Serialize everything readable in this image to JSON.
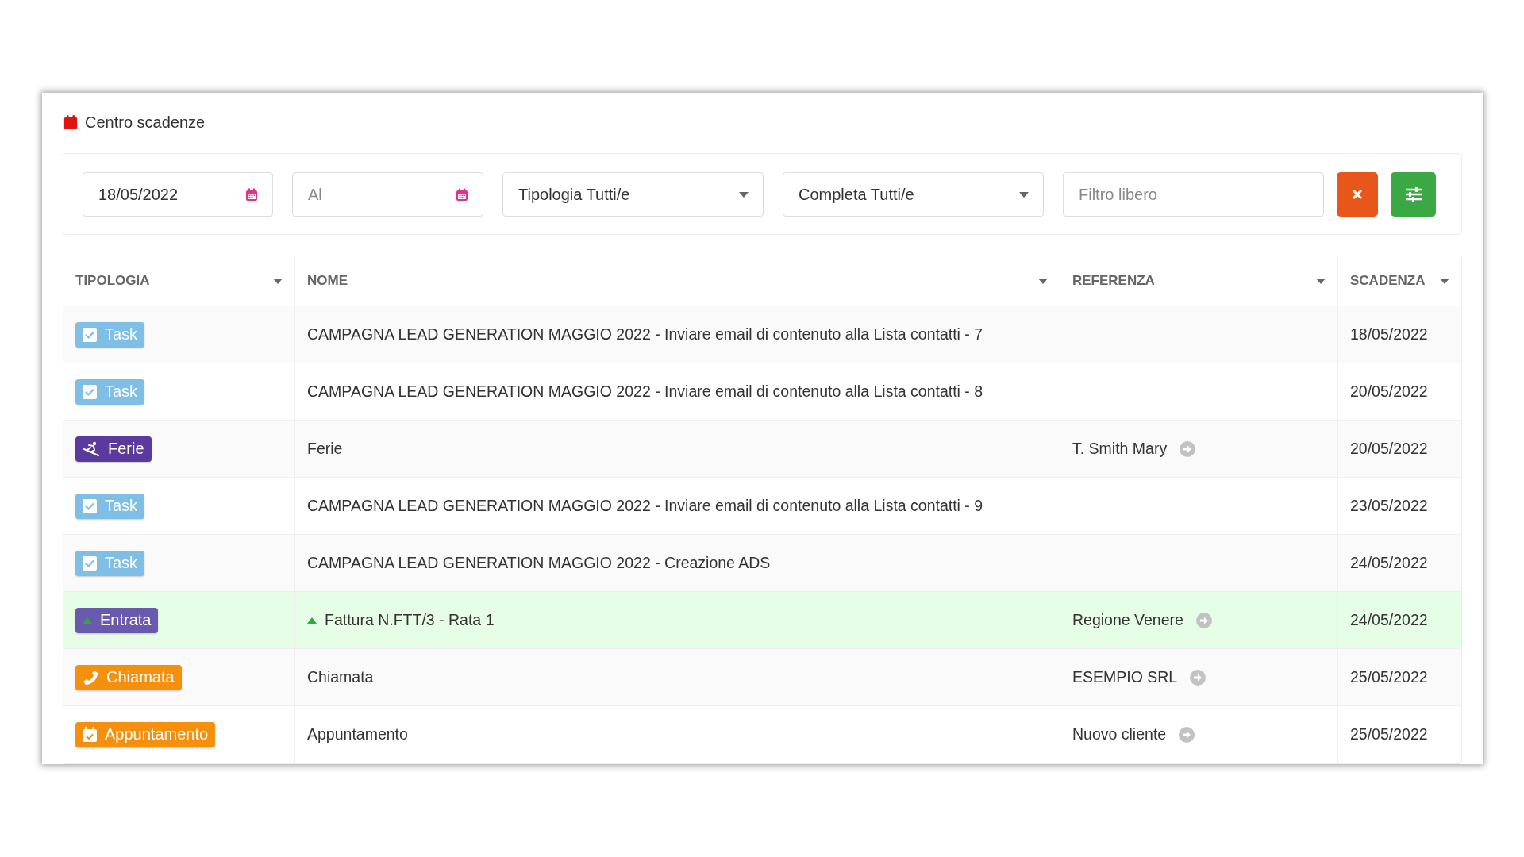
{
  "panel": {
    "title": "Centro scadenze"
  },
  "filters": {
    "date_from": {
      "value": "18/05/2022"
    },
    "date_to": {
      "placeholder": "Al"
    },
    "tipologia": {
      "value": "Tipologia Tutti/e"
    },
    "completa": {
      "value": "Completa Tutti/e"
    },
    "search": {
      "placeholder": "Filtro libero"
    }
  },
  "table": {
    "columns": [
      "TIPOLOGIA",
      "NOME",
      "REFERENZA",
      "SCADENZA"
    ],
    "rows": [
      {
        "kind": "task",
        "badge": "Task",
        "color": "#7fbfe6",
        "nome": "CAMPAGNA LEAD GENERATION MAGGIO 2022 - Inviare email di contenuto alla Lista contatti - 7",
        "scadenza": "18/05/2022",
        "highlighted": false
      },
      {
        "kind": "task",
        "badge": "Task",
        "color": "#7fbfe6",
        "nome": "CAMPAGNA LEAD GENERATION MAGGIO 2022 - Inviare email di contenuto alla Lista contatti - 8",
        "scadenza": "20/05/2022",
        "highlighted": false
      },
      {
        "kind": "ferie",
        "badge": "Ferie",
        "color": "#5a3a9c",
        "nome": "Ferie",
        "referenza": "T. Smith Mary",
        "scadenza": "20/05/2022",
        "highlighted": false
      },
      {
        "kind": "task",
        "badge": "Task",
        "color": "#7fbfe6",
        "nome": "CAMPAGNA LEAD GENERATION MAGGIO 2022 - Inviare email di contenuto alla Lista contatti - 9",
        "scadenza": "23/05/2022",
        "highlighted": false
      },
      {
        "kind": "task",
        "badge": "Task",
        "color": "#7fbfe6",
        "nome": "CAMPAGNA LEAD GENERATION MAGGIO 2022 - Creazione ADS",
        "scadenza": "24/05/2022",
        "highlighted": false
      },
      {
        "kind": "entrata",
        "badge": "Entrata",
        "color": "#6a5aae",
        "nome": "Fattura N.FTT/3 - Rata 1",
        "referenza": "Regione Venere",
        "scadenza": "24/05/2022",
        "highlighted": true
      },
      {
        "kind": "chiamata",
        "badge": "Chiamata",
        "color": "#f5900e",
        "nome": "Chiamata",
        "referenza": "ESEMPIO SRL",
        "scadenza": "25/05/2022",
        "highlighted": false
      },
      {
        "kind": "appuntamento",
        "badge": "Appuntamento",
        "color": "#f5900e",
        "nome": "Appuntamento",
        "referenza": "Nuovo cliente",
        "scadenza": "25/05/2022",
        "highlighted": false
      }
    ]
  }
}
